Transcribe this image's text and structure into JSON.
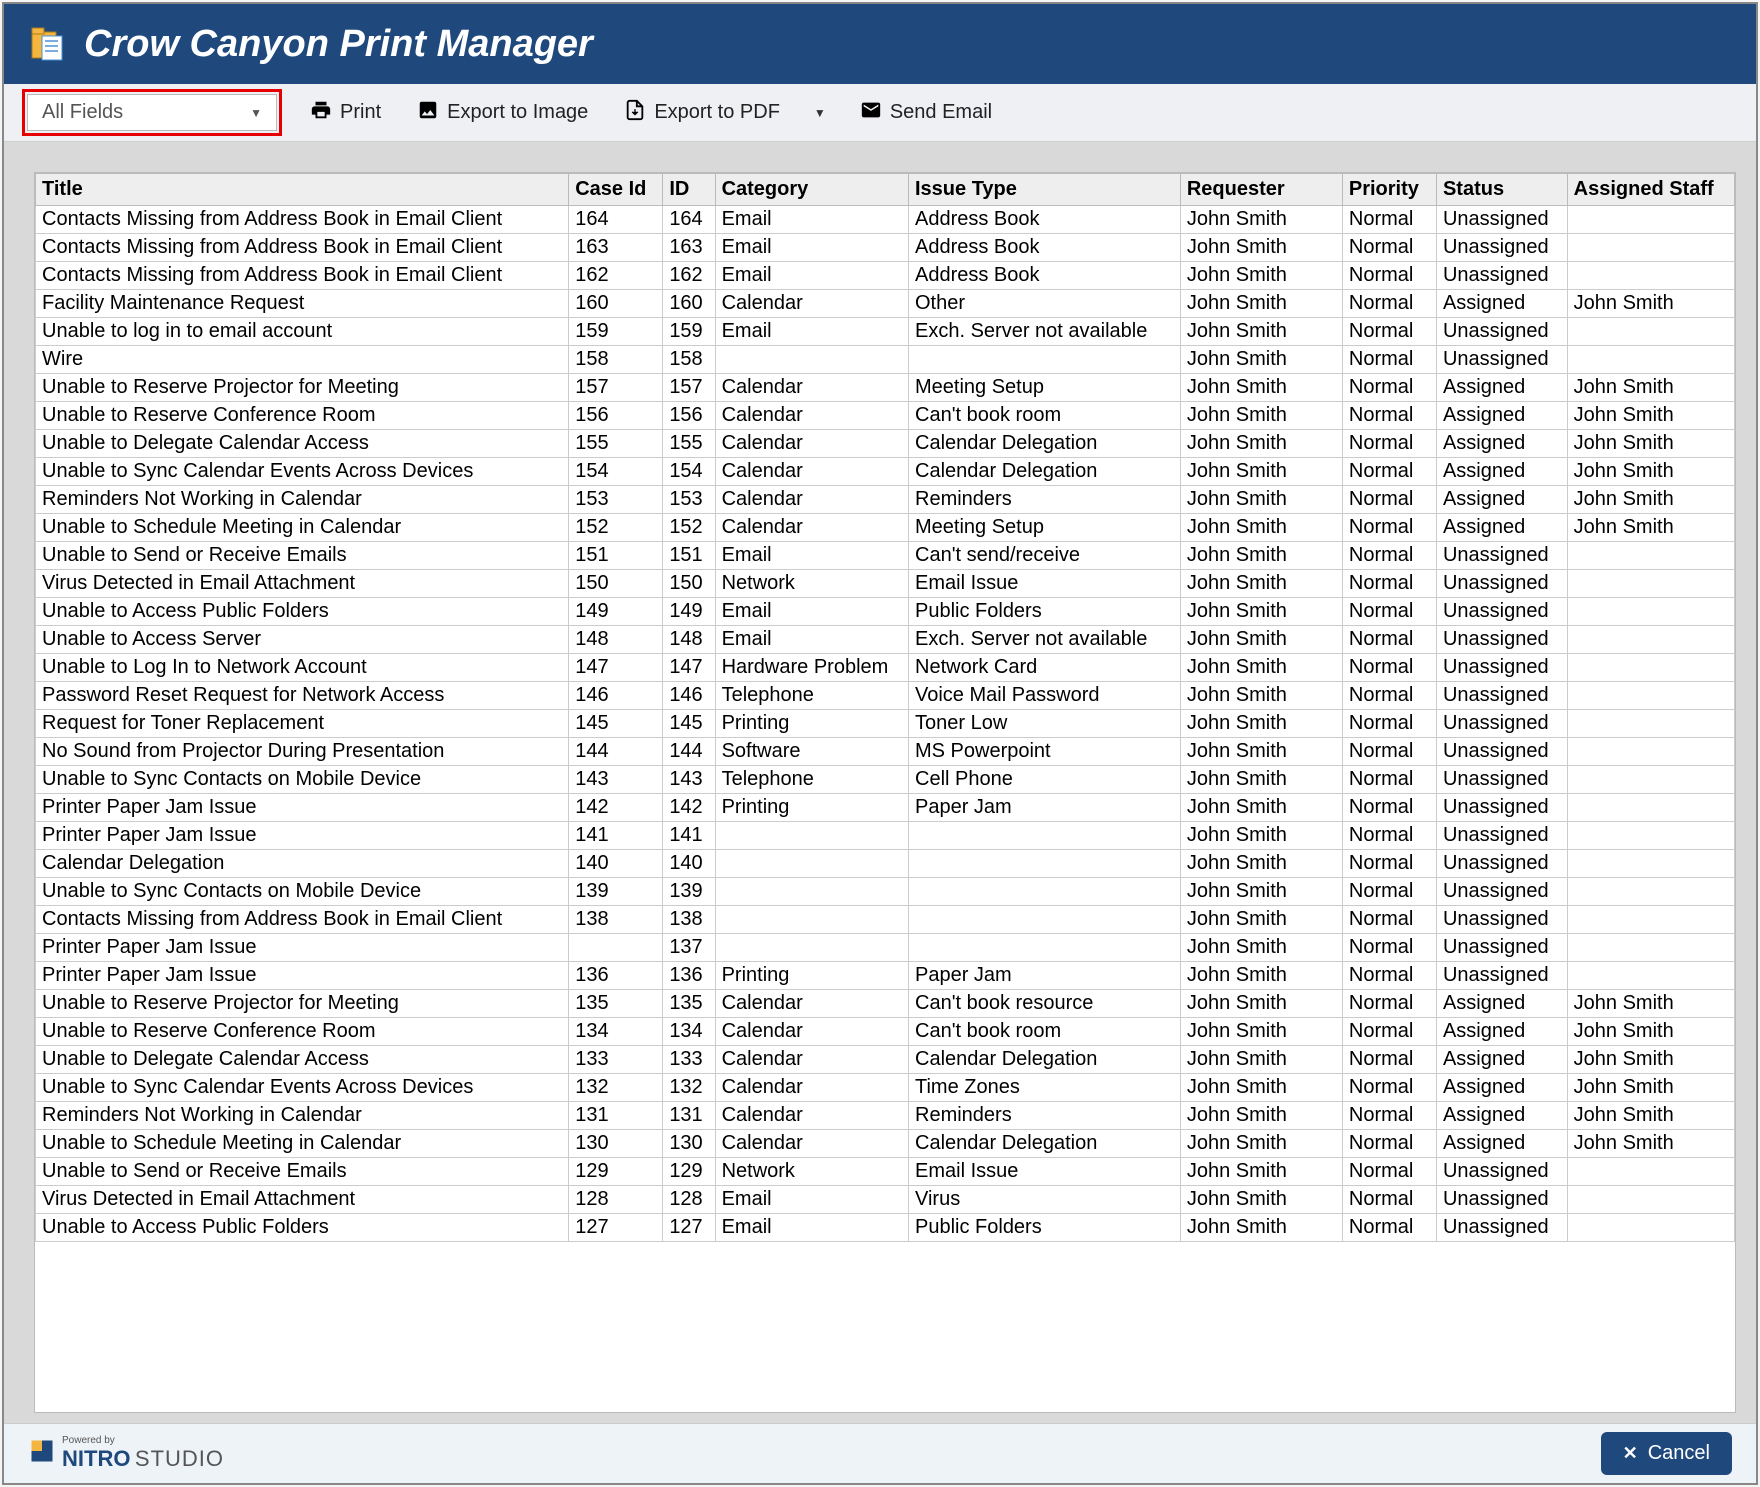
{
  "header": {
    "title": "Crow Canyon Print Manager"
  },
  "toolbar": {
    "fields_selector": "All Fields",
    "print": "Print",
    "export_image": "Export to Image",
    "export_pdf": "Export to PDF",
    "send_email": "Send Email"
  },
  "table": {
    "columns": [
      "Title",
      "Case Id",
      "ID",
      "Category",
      "Issue Type",
      "Requester",
      "Priority",
      "Status",
      "Assigned Staff"
    ],
    "rows": [
      {
        "title": "Contacts Missing from Address Book in Email Client",
        "case_id": "164",
        "id": "164",
        "category": "Email",
        "issue_type": "Address Book",
        "requester": "John Smith",
        "priority": "Normal",
        "status": "Unassigned",
        "assigned": ""
      },
      {
        "title": "Contacts Missing from Address Book in Email Client",
        "case_id": "163",
        "id": "163",
        "category": "Email",
        "issue_type": "Address Book",
        "requester": "John Smith",
        "priority": "Normal",
        "status": "Unassigned",
        "assigned": ""
      },
      {
        "title": "Contacts Missing from Address Book in Email Client",
        "case_id": "162",
        "id": "162",
        "category": "Email",
        "issue_type": "Address Book",
        "requester": "John Smith",
        "priority": "Normal",
        "status": "Unassigned",
        "assigned": ""
      },
      {
        "title": "Facility Maintenance Request",
        "case_id": "160",
        "id": "160",
        "category": "Calendar",
        "issue_type": "Other",
        "requester": "John Smith",
        "priority": "Normal",
        "status": "Assigned",
        "assigned": "John Smith"
      },
      {
        "title": "Unable to log in to email account",
        "case_id": "159",
        "id": "159",
        "category": "Email",
        "issue_type": "Exch. Server not available",
        "requester": "John Smith",
        "priority": "Normal",
        "status": "Unassigned",
        "assigned": ""
      },
      {
        "title": "Wire",
        "case_id": "158",
        "id": "158",
        "category": "",
        "issue_type": "",
        "requester": "John Smith",
        "priority": "Normal",
        "status": "Unassigned",
        "assigned": ""
      },
      {
        "title": "Unable to Reserve Projector for Meeting",
        "case_id": "157",
        "id": "157",
        "category": "Calendar",
        "issue_type": "Meeting Setup",
        "requester": "John Smith",
        "priority": "Normal",
        "status": "Assigned",
        "assigned": "John Smith"
      },
      {
        "title": "Unable to Reserve Conference Room",
        "case_id": "156",
        "id": "156",
        "category": "Calendar",
        "issue_type": "Can't book room",
        "requester": "John Smith",
        "priority": "Normal",
        "status": "Assigned",
        "assigned": "John Smith"
      },
      {
        "title": "Unable to Delegate Calendar Access",
        "case_id": "155",
        "id": "155",
        "category": "Calendar",
        "issue_type": "Calendar Delegation",
        "requester": "John Smith",
        "priority": "Normal",
        "status": "Assigned",
        "assigned": "John Smith"
      },
      {
        "title": "Unable to Sync Calendar Events Across Devices",
        "case_id": "154",
        "id": "154",
        "category": "Calendar",
        "issue_type": "Calendar Delegation",
        "requester": "John Smith",
        "priority": "Normal",
        "status": "Assigned",
        "assigned": "John Smith"
      },
      {
        "title": "Reminders Not Working in Calendar",
        "case_id": "153",
        "id": "153",
        "category": "Calendar",
        "issue_type": "Reminders",
        "requester": "John Smith",
        "priority": "Normal",
        "status": "Assigned",
        "assigned": "John Smith"
      },
      {
        "title": "Unable to Schedule Meeting in Calendar",
        "case_id": "152",
        "id": "152",
        "category": "Calendar",
        "issue_type": "Meeting Setup",
        "requester": "John Smith",
        "priority": "Normal",
        "status": "Assigned",
        "assigned": "John Smith"
      },
      {
        "title": "Unable to Send or Receive Emails",
        "case_id": "151",
        "id": "151",
        "category": "Email",
        "issue_type": "Can't send/receive",
        "requester": "John Smith",
        "priority": "Normal",
        "status": "Unassigned",
        "assigned": ""
      },
      {
        "title": "Virus Detected in Email Attachment",
        "case_id": "150",
        "id": "150",
        "category": "Network",
        "issue_type": "Email Issue",
        "requester": "John Smith",
        "priority": "Normal",
        "status": "Unassigned",
        "assigned": ""
      },
      {
        "title": "Unable to Access Public Folders",
        "case_id": "149",
        "id": "149",
        "category": "Email",
        "issue_type": "Public Folders",
        "requester": "John Smith",
        "priority": "Normal",
        "status": "Unassigned",
        "assigned": ""
      },
      {
        "title": "Unable to Access Server",
        "case_id": "148",
        "id": "148",
        "category": "Email",
        "issue_type": "Exch. Server not available",
        "requester": "John Smith",
        "priority": "Normal",
        "status": "Unassigned",
        "assigned": ""
      },
      {
        "title": "Unable to Log In to Network Account",
        "case_id": "147",
        "id": "147",
        "category": "Hardware Problem",
        "issue_type": "Network Card",
        "requester": "John Smith",
        "priority": "Normal",
        "status": "Unassigned",
        "assigned": ""
      },
      {
        "title": "Password Reset Request for Network Access",
        "case_id": "146",
        "id": "146",
        "category": "Telephone",
        "issue_type": "Voice Mail Password",
        "requester": "John Smith",
        "priority": "Normal",
        "status": "Unassigned",
        "assigned": ""
      },
      {
        "title": "Request for Toner Replacement",
        "case_id": "145",
        "id": "145",
        "category": "Printing",
        "issue_type": "Toner Low",
        "requester": "John Smith",
        "priority": "Normal",
        "status": "Unassigned",
        "assigned": ""
      },
      {
        "title": "No Sound from Projector During Presentation",
        "case_id": "144",
        "id": "144",
        "category": "Software",
        "issue_type": "MS Powerpoint",
        "requester": "John Smith",
        "priority": "Normal",
        "status": "Unassigned",
        "assigned": ""
      },
      {
        "title": "Unable to Sync Contacts on Mobile Device",
        "case_id": "143",
        "id": "143",
        "category": "Telephone",
        "issue_type": "Cell Phone",
        "requester": "John Smith",
        "priority": "Normal",
        "status": "Unassigned",
        "assigned": ""
      },
      {
        "title": "Printer Paper Jam Issue",
        "case_id": "142",
        "id": "142",
        "category": "Printing",
        "issue_type": "Paper Jam",
        "requester": "John Smith",
        "priority": "Normal",
        "status": "Unassigned",
        "assigned": ""
      },
      {
        "title": "Printer Paper Jam Issue",
        "case_id": "141",
        "id": "141",
        "category": "",
        "issue_type": "",
        "requester": "John Smith",
        "priority": "Normal",
        "status": "Unassigned",
        "assigned": ""
      },
      {
        "title": "Calendar Delegation",
        "case_id": "140",
        "id": "140",
        "category": "",
        "issue_type": "",
        "requester": "John Smith",
        "priority": "Normal",
        "status": "Unassigned",
        "assigned": ""
      },
      {
        "title": "Unable to Sync Contacts on Mobile Device",
        "case_id": "139",
        "id": "139",
        "category": "",
        "issue_type": "",
        "requester": "John Smith",
        "priority": "Normal",
        "status": "Unassigned",
        "assigned": ""
      },
      {
        "title": "Contacts Missing from Address Book in Email Client",
        "case_id": "138",
        "id": "138",
        "category": "",
        "issue_type": "",
        "requester": "John Smith",
        "priority": "Normal",
        "status": "Unassigned",
        "assigned": ""
      },
      {
        "title": "Printer Paper Jam Issue",
        "case_id": "",
        "id": "137",
        "category": "",
        "issue_type": "",
        "requester": "John Smith",
        "priority": "Normal",
        "status": "Unassigned",
        "assigned": ""
      },
      {
        "title": "Printer Paper Jam Issue",
        "case_id": "136",
        "id": "136",
        "category": "Printing",
        "issue_type": "Paper Jam",
        "requester": "John Smith",
        "priority": "Normal",
        "status": "Unassigned",
        "assigned": ""
      },
      {
        "title": "Unable to Reserve Projector for Meeting",
        "case_id": "135",
        "id": "135",
        "category": "Calendar",
        "issue_type": "Can't book resource",
        "requester": "John Smith",
        "priority": "Normal",
        "status": "Assigned",
        "assigned": "John Smith"
      },
      {
        "title": "Unable to Reserve Conference Room",
        "case_id": "134",
        "id": "134",
        "category": "Calendar",
        "issue_type": "Can't book room",
        "requester": "John Smith",
        "priority": "Normal",
        "status": "Assigned",
        "assigned": "John Smith"
      },
      {
        "title": "Unable to Delegate Calendar Access",
        "case_id": "133",
        "id": "133",
        "category": "Calendar",
        "issue_type": "Calendar Delegation",
        "requester": "John Smith",
        "priority": "Normal",
        "status": "Assigned",
        "assigned": "John Smith"
      },
      {
        "title": "Unable to Sync Calendar Events Across Devices",
        "case_id": "132",
        "id": "132",
        "category": "Calendar",
        "issue_type": "Time Zones",
        "requester": "John Smith",
        "priority": "Normal",
        "status": "Assigned",
        "assigned": "John Smith"
      },
      {
        "title": "Reminders Not Working in Calendar",
        "case_id": "131",
        "id": "131",
        "category": "Calendar",
        "issue_type": "Reminders",
        "requester": "John Smith",
        "priority": "Normal",
        "status": "Assigned",
        "assigned": "John Smith"
      },
      {
        "title": "Unable to Schedule Meeting in Calendar",
        "case_id": "130",
        "id": "130",
        "category": "Calendar",
        "issue_type": "Calendar Delegation",
        "requester": "John Smith",
        "priority": "Normal",
        "status": "Assigned",
        "assigned": "John Smith"
      },
      {
        "title": "Unable to Send or Receive Emails",
        "case_id": "129",
        "id": "129",
        "category": "Network",
        "issue_type": "Email Issue",
        "requester": "John Smith",
        "priority": "Normal",
        "status": "Unassigned",
        "assigned": ""
      },
      {
        "title": "Virus Detected in Email Attachment",
        "case_id": "128",
        "id": "128",
        "category": "Email",
        "issue_type": "Virus",
        "requester": "John Smith",
        "priority": "Normal",
        "status": "Unassigned",
        "assigned": ""
      },
      {
        "title": "Unable to Access Public Folders",
        "case_id": "127",
        "id": "127",
        "category": "Email",
        "issue_type": "Public Folders",
        "requester": "John Smith",
        "priority": "Normal",
        "status": "Unassigned",
        "assigned": ""
      }
    ]
  },
  "footer": {
    "powered_by": "Powered by",
    "nitro": "NITRO",
    "studio": "STUDIO",
    "cancel": "Cancel"
  }
}
